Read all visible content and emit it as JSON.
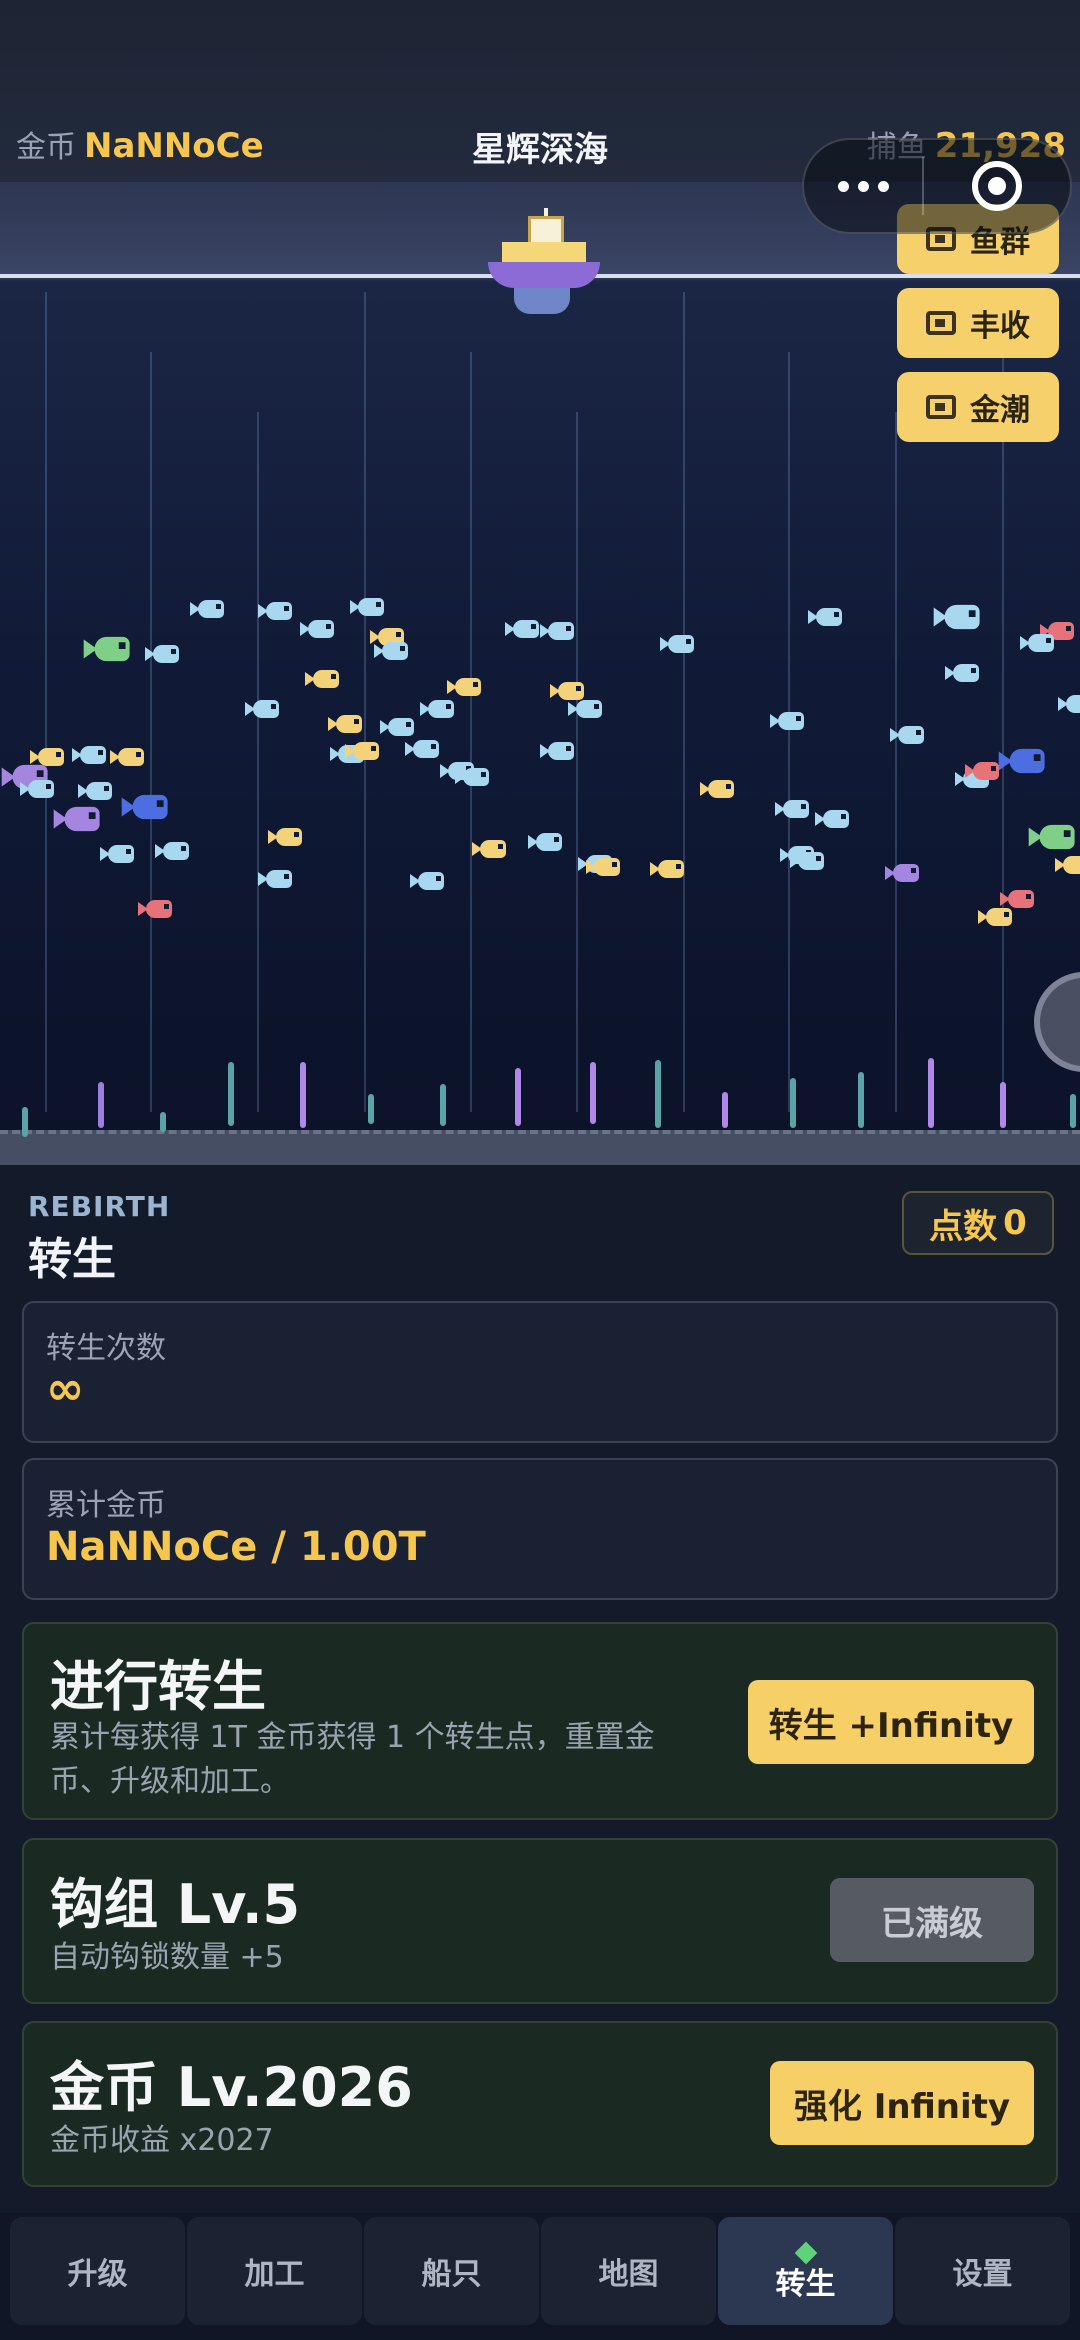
{
  "header": {
    "coins_label": "金币",
    "coins_value": "NaNNoCe",
    "title": "星辉深海",
    "caught_label": "捕鱼",
    "caught_value": "21,928"
  },
  "capsule": {
    "more_icon": "more-dots-icon",
    "close_icon": "target-close-icon"
  },
  "bonuses": [
    {
      "label": "鱼群",
      "icon": "tv-icon"
    },
    {
      "label": "丰收",
      "icon": "tv-icon"
    },
    {
      "label": "金潮",
      "icon": "tv-icon"
    }
  ],
  "rebirth": {
    "eyebrow": "REBIRTH",
    "title": "转生",
    "points_label": "点数",
    "points_value": "0",
    "count_label": "转生次数",
    "count_value": "∞",
    "total_label": "累计金币",
    "total_value": "NaNNoCe / 1.00T",
    "action_title": "进行转生",
    "action_desc": "累计每获得 1T 金币获得 1 个转生点，重置金币、升级和加工。",
    "action_button": "转生 +Infinity"
  },
  "upgrades": [
    {
      "title": "钩组 Lv.5",
      "desc": "自动钩锁数量 +5",
      "button": "已满级",
      "maxed": true
    },
    {
      "title": "金币 Lv.2026",
      "desc": "金币收益 x2027",
      "button": "强化 Infinity",
      "maxed": false
    }
  ],
  "nav": {
    "tabs": [
      "升级",
      "加工",
      "船只",
      "地图",
      "转生",
      "设置"
    ],
    "active": "转生"
  },
  "colors": {
    "accent_gold": "#f6c64f",
    "button_yellow": "#f6cf66",
    "panel_bg": "#131a2a",
    "active_gem": "#5fd37a"
  }
}
